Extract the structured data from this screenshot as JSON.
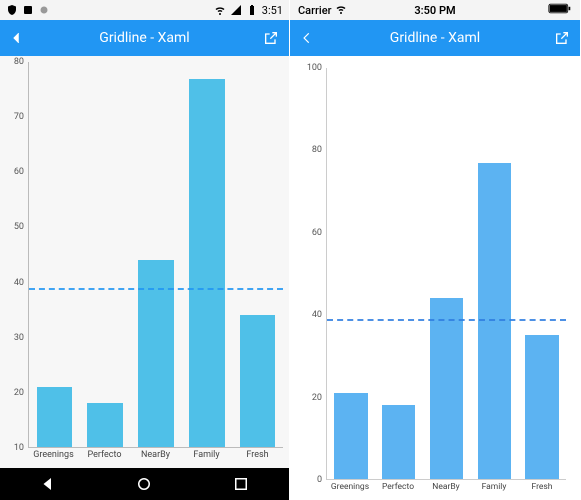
{
  "android": {
    "status_time": "3:51",
    "title": "Gridline - Xaml"
  },
  "ios": {
    "status_carrier": "Carrier",
    "status_time": "3:50 PM",
    "title": "Gridline - Xaml"
  },
  "chart_data": [
    {
      "type": "bar",
      "platform": "android",
      "categories": [
        "Greenings",
        "Perfecto",
        "NearBy",
        "Family",
        "Fresh"
      ],
      "values": [
        21,
        18,
        44,
        77,
        34
      ],
      "ylim": [
        10,
        80
      ],
      "ytick_step": 10,
      "stripline": 38.5,
      "bar_color": "#4fc0e8",
      "stripline_color": "#2196f3"
    },
    {
      "type": "bar",
      "platform": "ios",
      "categories": [
        "Greenings",
        "Perfecto",
        "NearBy",
        "Family",
        "Fresh"
      ],
      "values": [
        21,
        18,
        44,
        77,
        35
      ],
      "ylim": [
        0,
        100
      ],
      "ytick_step": 20,
      "stripline": 38.5,
      "bar_color": "#5cb3f2",
      "stripline_color": "#2f7de1"
    }
  ]
}
